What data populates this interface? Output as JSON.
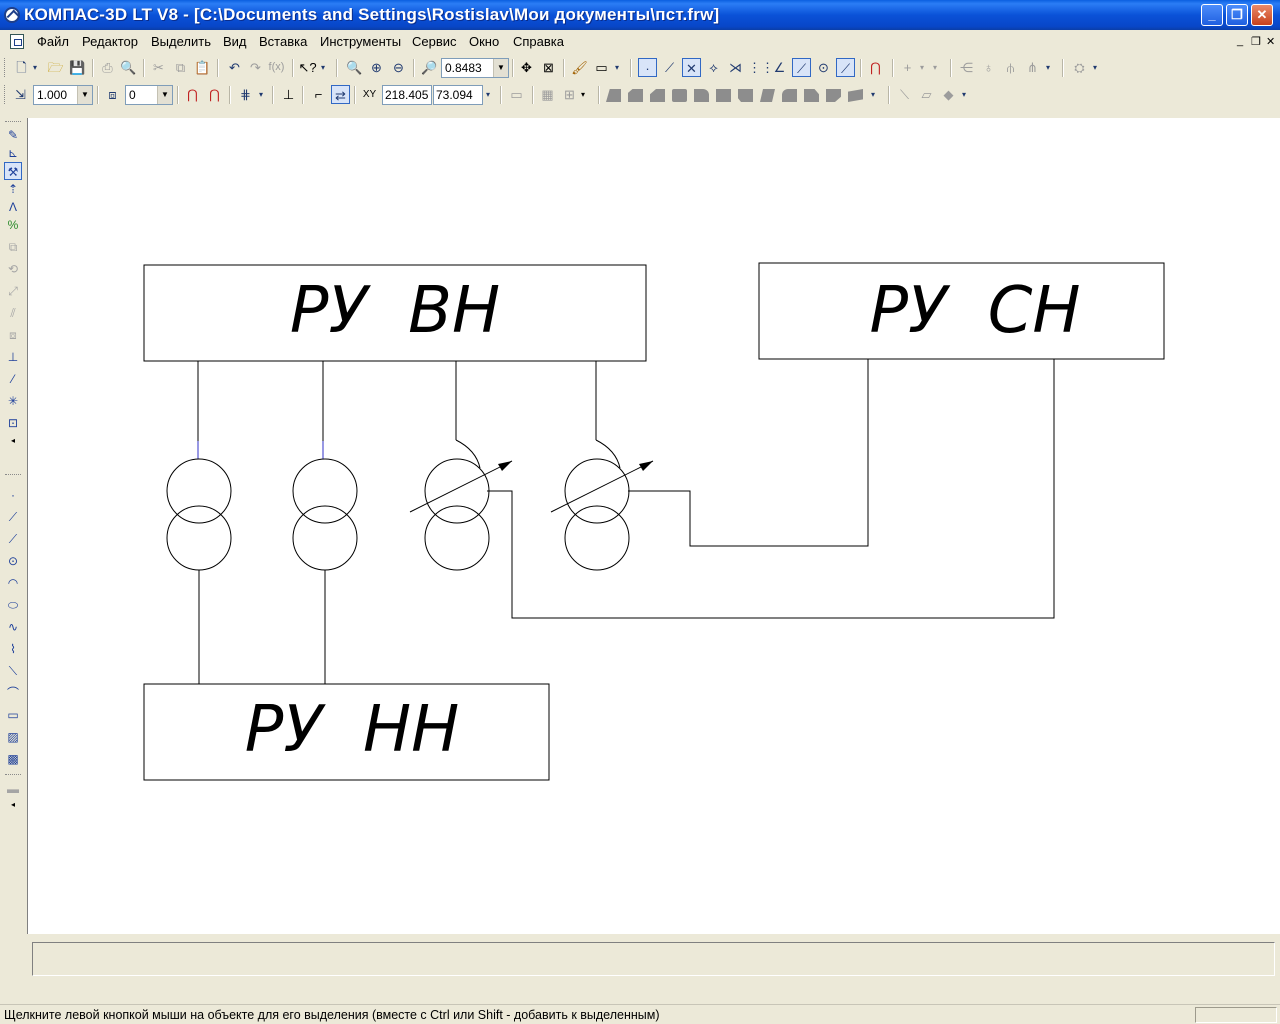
{
  "window": {
    "title": "КОМПАС-3D LT V8 - [C:\\Documents and Settings\\Rostislav\\Мои документы\\пст.frw]",
    "minimize_icon": "minimize-icon",
    "maximize_icon": "restore-icon",
    "close_icon": "close-icon"
  },
  "menu": {
    "items": [
      "Файл",
      "Редактор",
      "Выделить",
      "Вид",
      "Вставка",
      "Инструменты",
      "Сервис",
      "Окно",
      "Справка"
    ]
  },
  "toolbar1": {
    "zoom_value": "0.8483"
  },
  "toolbar2": {
    "scale_value": "1.000",
    "layer_value": "0",
    "coord_x": "218.405",
    "coord_y": "73.094"
  },
  "drawing": {
    "blocks": {
      "vn": "РУ  ВН",
      "sn": "РУ  СН",
      "nn": "РУ  НН"
    },
    "line_color": "#000000",
    "highlight_color": "#3030c8"
  },
  "status": {
    "text": "Щелкните левой кнопкой мыши на объекте для его выделения (вместе с Ctrl или Shift - добавить к выделенным)"
  }
}
